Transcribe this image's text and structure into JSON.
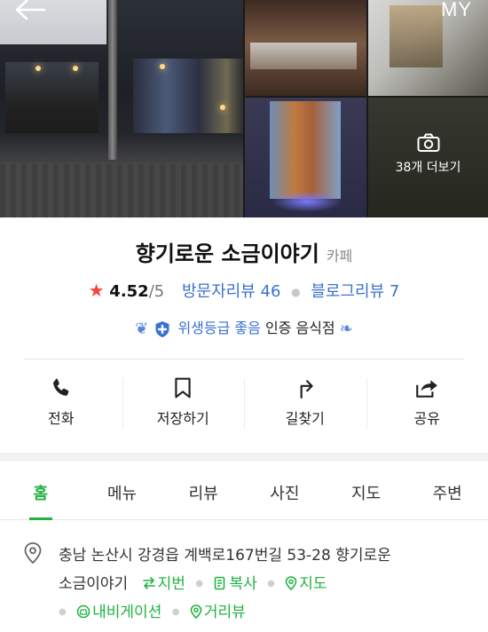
{
  "header": {
    "back_icon": "arrow-left-icon",
    "my_label": "MY",
    "more_photos_label": "38개 더보기",
    "camera_icon": "camera-icon"
  },
  "place": {
    "name": "향기로운 소금이야기",
    "category": "카페",
    "rating": "4.52",
    "rating_max": "/5",
    "visitor_reviews": "방문자리뷰 46",
    "blog_reviews": "블로그리뷰 7",
    "hygiene_grade": "위생등급 좋음",
    "certified_label": "인증 음식점"
  },
  "actions": [
    {
      "label": "전화",
      "icon": "phone-icon"
    },
    {
      "label": "저장하기",
      "icon": "bookmark-icon"
    },
    {
      "label": "길찾기",
      "icon": "directions-icon"
    },
    {
      "label": "공유",
      "icon": "share-icon"
    }
  ],
  "tabs": [
    {
      "label": "홈",
      "active": true
    },
    {
      "label": "메뉴",
      "active": false
    },
    {
      "label": "리뷰",
      "active": false
    },
    {
      "label": "사진",
      "active": false
    },
    {
      "label": "지도",
      "active": false
    },
    {
      "label": "주변",
      "active": false
    }
  ],
  "address": {
    "line1": "충남 논산시 강경읍 계백로167번길 53-28 향기로운",
    "line2": "소금이야기",
    "jibun_label": "지번",
    "copy_label": "복사",
    "map_label": "지도",
    "navigation_label": "내비게이션",
    "street_view_label": "거리뷰"
  },
  "colors": {
    "accent_green": "#1fb340",
    "link_blue": "#3a70d1",
    "star_red": "#f2453d"
  }
}
